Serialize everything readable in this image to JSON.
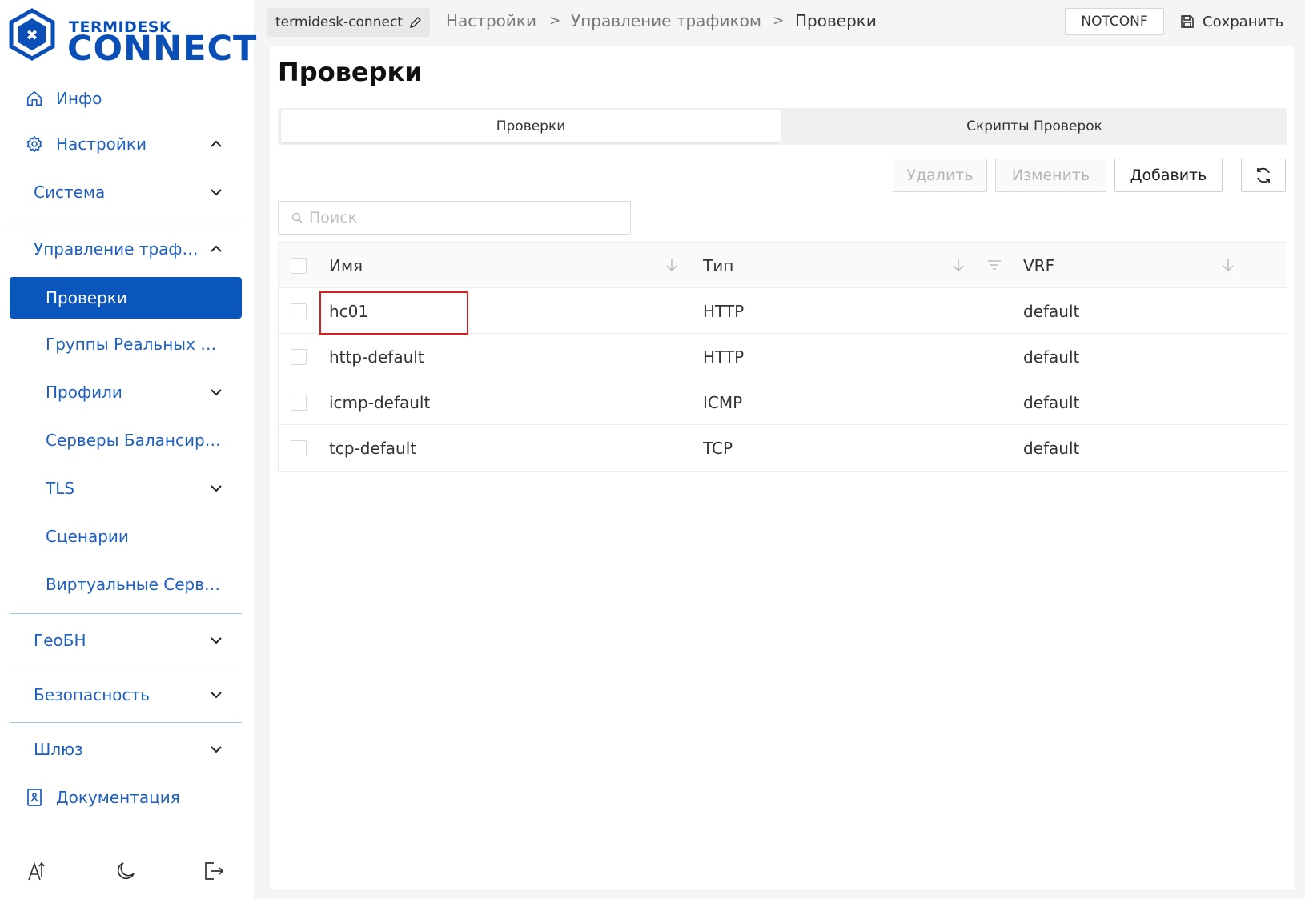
{
  "logo": {
    "small": "TERMIDESK",
    "big": "CONNECT"
  },
  "sidebar": {
    "items": [
      {
        "label": "Инфо",
        "icon": "home-icon"
      },
      {
        "label": "Настройки",
        "icon": "gear-icon"
      },
      {
        "label": "Система"
      },
      {
        "label": "Управление трафиком"
      },
      {
        "label": "Проверки"
      },
      {
        "label": "Группы Реальных Серверов"
      },
      {
        "label": "Профили"
      },
      {
        "label": "Серверы Балансировки"
      },
      {
        "label": "TLS"
      },
      {
        "label": "Сценарии"
      },
      {
        "label": "Виртуальные Серверы"
      },
      {
        "label": "ГеоБН"
      },
      {
        "label": "Безопасность"
      },
      {
        "label": "Шлюз"
      },
      {
        "label": "Документация",
        "icon": "book-icon"
      }
    ],
    "bottom_icons": [
      "font-size-icon",
      "moon-icon",
      "logout-icon"
    ]
  },
  "topbar": {
    "host": "termidesk-connect",
    "breadcrumbs": [
      "Настройки",
      "Управление трафиком",
      "Проверки"
    ],
    "separator": ">",
    "status": "NOTCONF",
    "save_label": "Сохранить"
  },
  "page": {
    "title": "Проверки",
    "tabs": [
      "Проверки",
      "Скрипты Проверок"
    ],
    "actions": {
      "delete": "Удалить",
      "edit": "Изменить",
      "add": "Добавить"
    },
    "search_placeholder": "Поиск"
  },
  "table": {
    "columns": [
      "Имя",
      "Тип",
      "VRF"
    ],
    "rows": [
      {
        "name": "hc01",
        "type": "HTTP",
        "vrf": "default"
      },
      {
        "name": "http-default",
        "type": "HTTP",
        "vrf": "default"
      },
      {
        "name": "icmp-default",
        "type": "ICMP",
        "vrf": "default"
      },
      {
        "name": "tcp-default",
        "type": "TCP",
        "vrf": "default"
      }
    ]
  },
  "colors": {
    "accent": "#0b56bd",
    "link": "#1f5fbf",
    "highlight": "#d42020"
  }
}
